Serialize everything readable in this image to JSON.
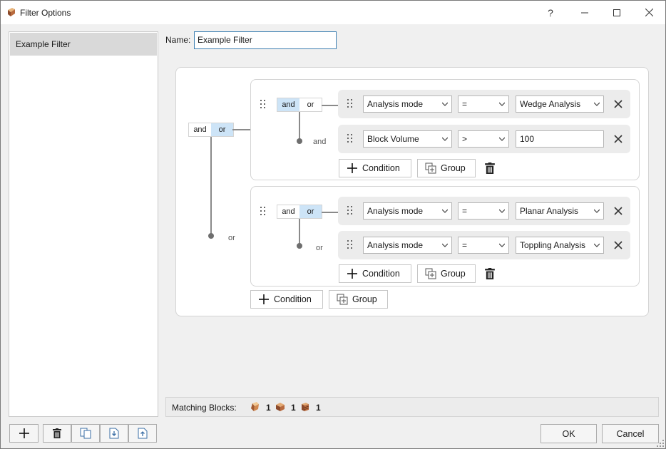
{
  "window": {
    "title": "Filter Options",
    "help_icon": "question-mark-icon",
    "minimize_icon": "minimize-icon",
    "maximize_icon": "maximize-icon",
    "close_icon": "close-icon"
  },
  "sidebar": {
    "items": [
      {
        "label": "Example Filter",
        "selected": true
      }
    ],
    "toolbar": [
      "add-icon",
      "delete-icon",
      "duplicate-icon",
      "import-icon",
      "export-icon"
    ]
  },
  "name": {
    "label": "Name:",
    "value": "Example Filter"
  },
  "root_group": {
    "operator": "or",
    "toggle": {
      "and": "and",
      "or": "or"
    },
    "connector_label": "or",
    "add_condition_label": "Condition",
    "add_group_label": "Group"
  },
  "group1": {
    "operator": "and",
    "toggle": {
      "and": "and",
      "or": "or"
    },
    "connector_label": "and",
    "conditions": [
      {
        "field": "Analysis mode",
        "op": "=",
        "value": "Wedge Analysis",
        "value_type": "dropdown"
      },
      {
        "field": "Block Volume",
        "op": ">",
        "value": "100",
        "value_type": "text"
      }
    ],
    "add_condition_label": "Condition",
    "add_group_label": "Group"
  },
  "group2": {
    "operator": "or",
    "toggle": {
      "and": "and",
      "or": "or"
    },
    "connector_label": "or",
    "conditions": [
      {
        "field": "Analysis mode",
        "op": "=",
        "value": "Planar Analysis",
        "value_type": "dropdown"
      },
      {
        "field": "Analysis mode",
        "op": "=",
        "value": "Toppling Analysis",
        "value_type": "dropdown"
      }
    ],
    "add_condition_label": "Condition",
    "add_group_label": "Group"
  },
  "status": {
    "label": "Matching Blocks:",
    "counts": [
      {
        "icon": "wedge-block-icon",
        "count": "1"
      },
      {
        "icon": "planar-block-icon",
        "count": "1"
      },
      {
        "icon": "toppling-block-icon",
        "count": "1"
      }
    ]
  },
  "buttons": {
    "ok": "OK",
    "cancel": "Cancel"
  },
  "colors": {
    "toggle_active": "#cde4f7",
    "focus_border": "#3c7fb1",
    "row_bg": "#ececec"
  }
}
